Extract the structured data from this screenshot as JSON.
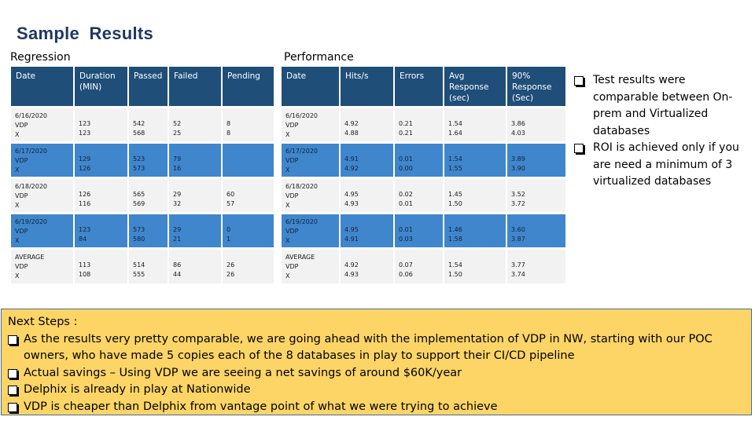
{
  "page": {
    "title": "Sample  Results"
  },
  "regression": {
    "label": "Regression",
    "headers": [
      "Date",
      "Duration\n(MIN)",
      "Passed",
      "Failed",
      "Pending"
    ],
    "rows": [
      {
        "date": "6/16/2020\nVDP\nX",
        "duration": "123\n123",
        "passed": "542\n568",
        "failed": "52\n25",
        "pending": "8\n8"
      },
      {
        "date": "6/17/2020\nVDP\nX",
        "duration": "129\n126",
        "passed": "523\n573",
        "failed": "79\n16",
        "pending": ""
      },
      {
        "date": "6/18/2020\nVDP\nX",
        "duration": "126\n116",
        "passed": "565\n569",
        "failed": "29\n32",
        "pending": "60\n57"
      },
      {
        "date": "6/19/2020\nVDP\nX",
        "duration": "123\n84",
        "passed": "573\n580",
        "failed": "29\n21",
        "pending": "0\n1"
      },
      {
        "date": "AVERAGE\nVDP\nX",
        "duration": "113\n108",
        "passed": "514\n555",
        "failed": "86\n44",
        "pending": "26\n26"
      }
    ]
  },
  "performance": {
    "label": "Performance",
    "headers": [
      "Date",
      "Hits/s",
      "Errors",
      "Avg\nResponse\n(sec)",
      "90%\nResponse\n(Sec)"
    ],
    "rows": [
      {
        "date": "6/16/2020\nVDP\nX",
        "hits": "4.92\n4.88",
        "errors": "0.21\n0.21",
        "avg": "1.54\n1.64",
        "p90": "3.86\n4.03"
      },
      {
        "date": "6/17/2020\nVDP\nX",
        "hits": "4.91\n4.92",
        "errors": "0.01\n0.00",
        "avg": "1.54\n1.55",
        "p90": "3.89\n3.90"
      },
      {
        "date": "6/18/2020\nVDP\nX",
        "hits": "4.95\n4.93",
        "errors": "0.02\n0.01",
        "avg": "1.45\n1.50",
        "p90": "3.52\n3.72"
      },
      {
        "date": "6/19/2020\nVDP\nX",
        "hits": "4.95\n4.91",
        "errors": "0.01\n0.03",
        "avg": "1.46\n1.58",
        "p90": "3.60\n3.87"
      },
      {
        "date": "AVERAGE\nVDP\nX",
        "hits": "4.92\n4.93",
        "errors": "0.07\n0.06",
        "avg": "1.54\n1.50",
        "p90": "3.77\n3.74"
      }
    ]
  },
  "summary_bullets": [
    "Test results were comparable between On-prem and Virtualized databases",
    "ROI is achieved only if you are need a minimum of 3 virtualized databases"
  ],
  "next_steps": {
    "heading": "Next Steps :",
    "items": [
      "As the results very pretty comparable, we are going ahead with the implementation of VDP in NW, starting with our POC owners, who have made 5 copies each of the 8 databases in play to support their CI/CD pipeline",
      "Actual savings – Using VDP we are seeing a net savings of around $60K/year",
      "Delphix is already in play at Nationwide",
      "VDP is cheaper than Delphix from vantage point of what we were trying to achieve"
    ]
  },
  "colors": {
    "header_bg": "#1f4e79",
    "row_blue": "#3f86cc",
    "row_light": "#f2f2f2",
    "next_steps_bg": "#fdd566",
    "title": "#1f3864"
  }
}
